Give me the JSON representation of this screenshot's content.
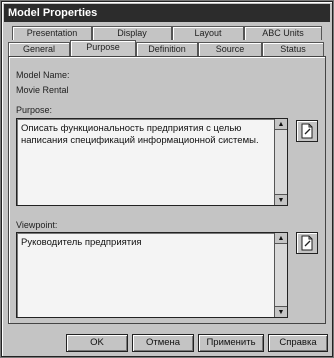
{
  "window": {
    "title": "Model Properties"
  },
  "tabs_back": [
    {
      "label": "Presentation"
    },
    {
      "label": "Display"
    },
    {
      "label": "Layout"
    },
    {
      "label": "ABC Units"
    }
  ],
  "tabs_front": [
    {
      "label": "General"
    },
    {
      "label": "Purpose",
      "active": true
    },
    {
      "label": "Definition"
    },
    {
      "label": "Source"
    },
    {
      "label": "Status"
    }
  ],
  "model": {
    "name_label": "Model Name:",
    "name_value": "Movie Rental"
  },
  "purpose": {
    "label": "Purpose:",
    "text": "Описать функциональность предприятия с целью написания спецификаций информационной системы."
  },
  "viewpoint": {
    "label": "Viewpoint:",
    "text": "Руководитель предприятия"
  },
  "buttons": {
    "ok": "OK",
    "cancel": "Отмена",
    "apply": "Применить",
    "help": "Справка"
  }
}
